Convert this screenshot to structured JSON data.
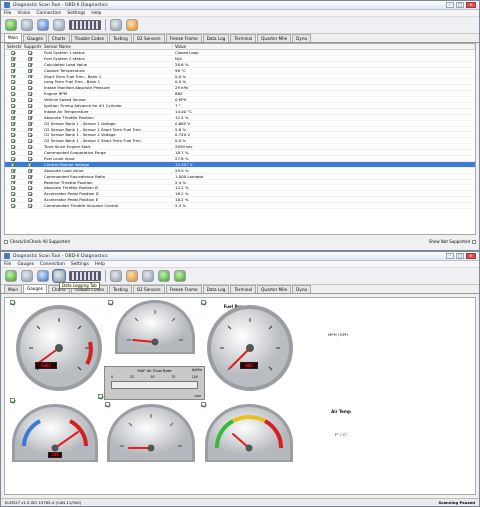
{
  "window1": {
    "title": "Diagnostic Scan Tool - OBD-II Diagnostics",
    "menu": [
      "File",
      "Vision",
      "Connection",
      "Settings",
      "Help"
    ],
    "tabs": [
      "Main",
      "Gauges",
      "Charts",
      "Trouble Codes",
      "Testing",
      "O2 Sensors",
      "Freeze Frame",
      "Data Log",
      "Terminal",
      "Quarter Mile",
      "Dyno"
    ],
    "columns": [
      "Selected",
      "Supported",
      "Sensor Name",
      "Value"
    ],
    "rows": [
      {
        "sensor": "Fuel System 1 status",
        "value": "Closed Loop"
      },
      {
        "sensor": "Fuel System 2 status",
        "value": "N/A"
      },
      {
        "sensor": "Calculated Load Value",
        "value": "28.6 %"
      },
      {
        "sensor": "Coolant Temperature",
        "value": "98 °C"
      },
      {
        "sensor": "Short Term Fuel Trim - Bank 1",
        "value": "0.0 %"
      },
      {
        "sensor": "Long Term Fuel Trim - Bank 1",
        "value": "0.0 %"
      },
      {
        "sensor": "Intake Manifold Absolute Pressure",
        "value": "29 kPa"
      },
      {
        "sensor": "Engine RPM",
        "value": "862"
      },
      {
        "sensor": "Vehicle Speed Sensor",
        "value": "0 KPH"
      },
      {
        "sensor": "Ignition Timing Advance for #1 Cylinder",
        "value": "7 °"
      },
      {
        "sensor": "Intake Air Temperature",
        "value": "14.00 °C"
      },
      {
        "sensor": "Absolute Throttle Position",
        "value": "12.5 %"
      },
      {
        "sensor": "O2 Sensor Bank 1 - Sensor 1 Voltage",
        "value": "0.665 V"
      },
      {
        "sensor": "O2 Sensor Bank 1 - Sensor 1 Short Term Fuel Trim",
        "value": "5.8 %"
      },
      {
        "sensor": "O2 Sensor Bank 1 - Sensor 2 Voltage",
        "value": "0.740 V"
      },
      {
        "sensor": "O2 Sensor Bank 1 - Sensor 2 Short Term Fuel Trim",
        "value": "0.0 %"
      },
      {
        "sensor": "Time Since Engine Start",
        "value": "2059 sec"
      },
      {
        "sensor": "Commanded Evaporative Purge",
        "value": "18.7 %"
      },
      {
        "sensor": "Fuel Level Input",
        "value": "27.8 %"
      },
      {
        "sensor": "Control Module Voltage",
        "value": "12.557 V"
      },
      {
        "sensor": "Absolute Load Value",
        "value": "29.0 %"
      },
      {
        "sensor": "Commanded Equivalence Ratio",
        "value": "1.000 Lambda"
      },
      {
        "sensor": "Relative Throttle Position",
        "value": "2.4 %"
      },
      {
        "sensor": "Absolute Throttle Position B",
        "value": "12.2 %"
      },
      {
        "sensor": "Accelerator Pedal Position D",
        "value": "18.2 %"
      },
      {
        "sensor": "Accelerator Pedal Position E",
        "value": "18.2 %"
      },
      {
        "sensor": "Commanded Throttle Actuator Control",
        "value": "2.4 %"
      }
    ],
    "highlight_index": 19,
    "check_all_label": "Check/UnCheck All Supported",
    "show_not_supported_label": "Show Not Supported"
  },
  "window2": {
    "title": "Diagnostic Scan Tool - OBD-II Diagnostics",
    "menu": [
      "File",
      "Gauges",
      "Connection",
      "Settings",
      "Help"
    ],
    "tabs": [
      "Main",
      "Gauges",
      "Charts",
      "Trouble Codes",
      "Testing",
      "O2 Sensors",
      "Freeze Frame",
      "Data Log",
      "Terminal",
      "Quarter Mile",
      "Dyno"
    ],
    "tooltip": "Data Logging Tab",
    "gauges": {
      "rpm": {
        "label": "RPM x 1000",
        "digital": "0862"
      },
      "fuel": {
        "title": "Fuel Pressure",
        "unit": "PSI / kPa"
      },
      "speed": {
        "unit": "MPH / KPH",
        "digital": "000"
      },
      "maf": {
        "title": "MAF Air Flow Rate",
        "unit": "lb/Min",
        "ticks": [
          "0",
          "25",
          "50",
          "75",
          "100"
        ],
        "subunit": "GPM"
      },
      "coolant": {
        "title": "Coolant",
        "unit": "F° / C°",
        "digital": "209"
      },
      "intake": {
        "title": "Intake Manifold",
        "unit": "PSI / kPa"
      },
      "airtemp": {
        "title": "Air Temp",
        "unit": "F° / C°"
      }
    },
    "status_left": "ELM327 v1.5  ISO 15765-4 (CAN 11/500)",
    "status_right": "Scanning Paused"
  },
  "colors": {
    "highlight": "#3b7bd4",
    "needle": "#e02020",
    "panel": "#f0f0f0"
  }
}
